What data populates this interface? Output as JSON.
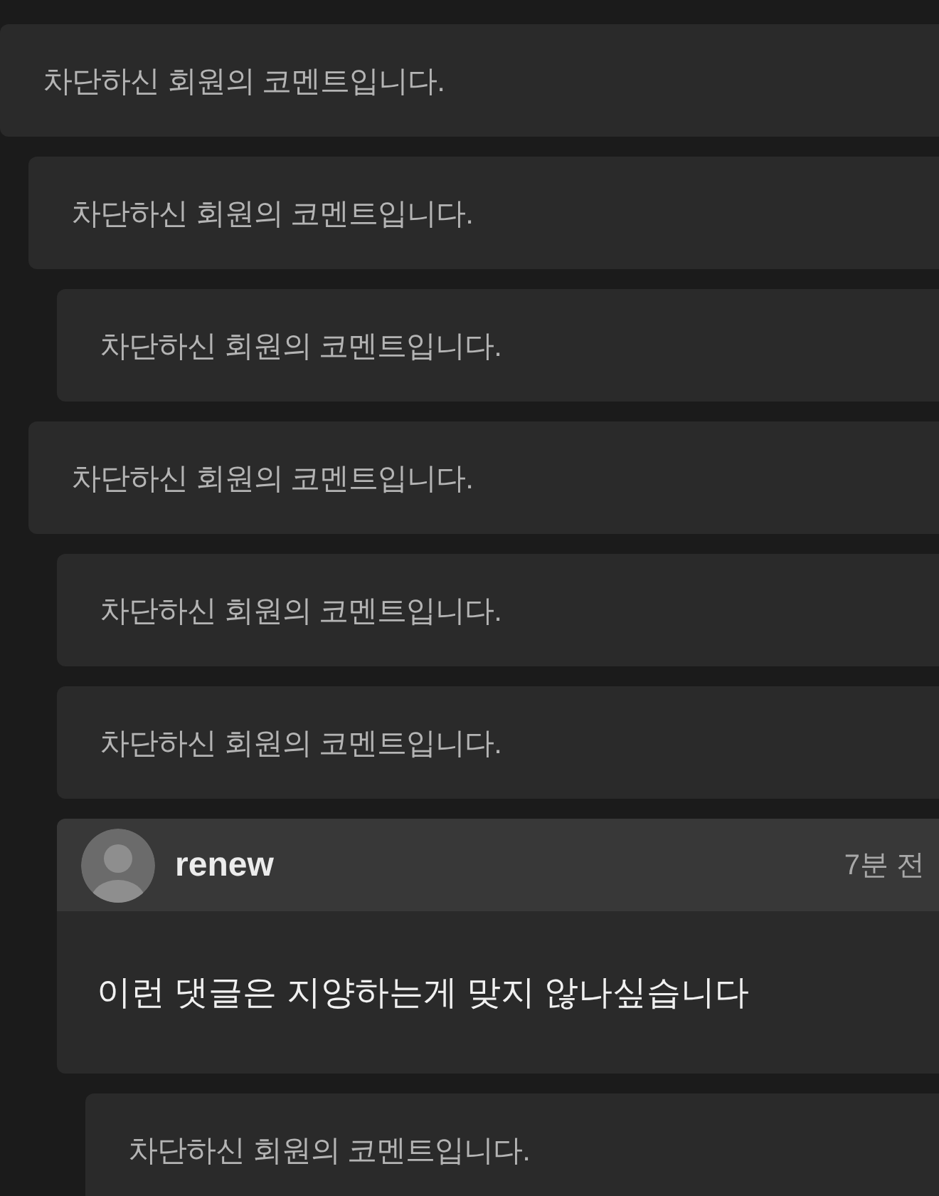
{
  "comments": [
    {
      "kind": "blocked",
      "text": "차단하신 회원의 코멘트입니다.",
      "children": [
        {
          "kind": "blocked",
          "text": "차단하신 회원의 코멘트입니다.",
          "children": [
            {
              "kind": "blocked",
              "text": "차단하신 회원의 코멘트입니다."
            }
          ]
        },
        {
          "kind": "blocked",
          "text": "차단하신 회원의 코멘트입니다.",
          "children": [
            {
              "kind": "blocked",
              "text": "차단하신 회원의 코멘트입니다."
            },
            {
              "kind": "blocked",
              "text": "차단하신 회원의 코멘트입니다."
            },
            {
              "kind": "comment",
              "author": "renew",
              "time": "7분 전",
              "text": "이런 댓글은 지양하는게 맞지 않나싶습니다",
              "children": [
                {
                  "kind": "blocked",
                  "text": "차단하신 회원의 코멘트입니다."
                }
              ]
            }
          ]
        }
      ]
    }
  ]
}
